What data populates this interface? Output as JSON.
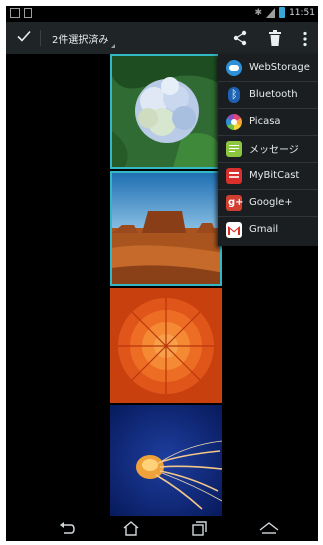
{
  "status_bar": {
    "time": "11:51"
  },
  "action_bar": {
    "title": "2件選択済み"
  },
  "share_menu": {
    "items": [
      {
        "label": "WebStorage",
        "icon": "webstorage-icon",
        "color": "#2f8fd8"
      },
      {
        "label": "Bluetooth",
        "icon": "bluetooth-icon",
        "color": "#1e63b3"
      },
      {
        "label": "Picasa",
        "icon": "picasa-icon",
        "color": "#e0457b"
      },
      {
        "label": "メッセージ",
        "icon": "message-icon",
        "color": "#8cc63f"
      },
      {
        "label": "MyBitCast",
        "icon": "mybitcast-icon",
        "color": "#d8302c"
      },
      {
        "label": "Google+",
        "icon": "google-plus-icon",
        "color": "#d23f31"
      },
      {
        "label": "Gmail",
        "icon": "gmail-icon",
        "color": "#d93025"
      }
    ]
  },
  "gallery": {
    "photos": [
      {
        "subject": "hydrangea",
        "selected": true
      },
      {
        "subject": "desert-butte",
        "selected": true
      },
      {
        "subject": "chrysanthemum",
        "selected": false
      },
      {
        "subject": "jellyfish",
        "selected": false
      }
    ]
  },
  "colors": {
    "selection": "#35b8c5",
    "action_bar": "#1f2427",
    "menu": "#1b1e20"
  }
}
